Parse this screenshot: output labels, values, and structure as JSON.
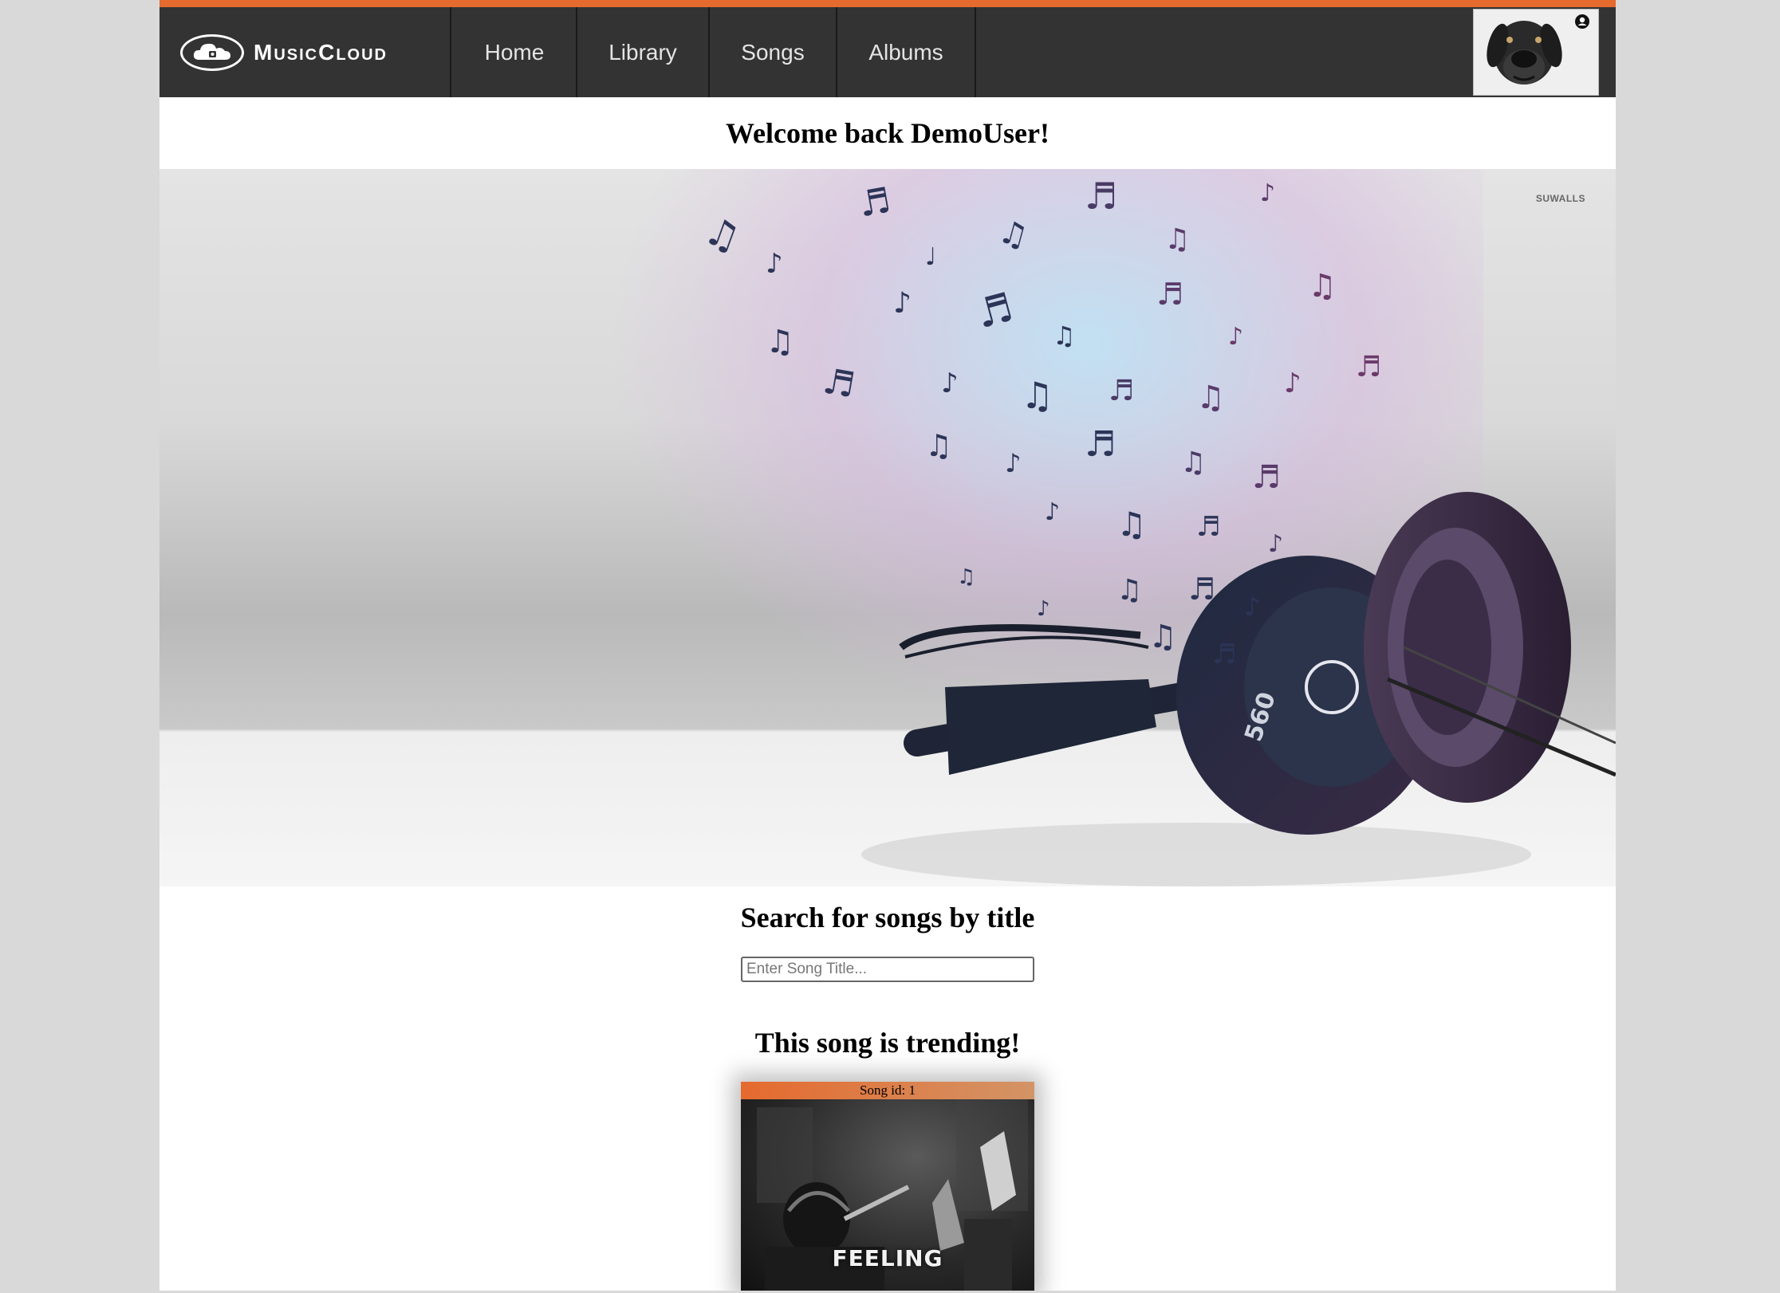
{
  "brand": {
    "name": "MusicCloud"
  },
  "nav": {
    "items": [
      {
        "label": "Home"
      },
      {
        "label": "Library"
      },
      {
        "label": "Songs"
      },
      {
        "label": "Albums"
      }
    ]
  },
  "welcome": {
    "text": "Welcome back DemoUser!"
  },
  "hero": {
    "watermark": "SUWALLS"
  },
  "search": {
    "title": "Search for songs by title",
    "placeholder": "Enter Song Title...",
    "value": ""
  },
  "trending": {
    "title": "This song is trending!",
    "song": {
      "id_label": "Song id: 1",
      "cover_text": "FEELING"
    }
  },
  "colors": {
    "accent": "#e56a2e",
    "navbar": "#333333",
    "page_background": "#d9d9d9"
  },
  "icons": {
    "logo": "cloud-logo-icon",
    "profile_badge": "user-circle-icon",
    "avatar": "dog-avatar"
  }
}
